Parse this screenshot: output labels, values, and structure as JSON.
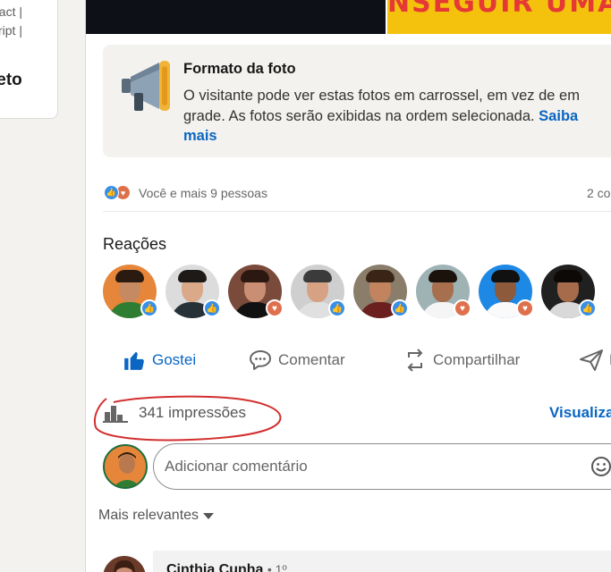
{
  "sidebar": {
    "line1": "eact |",
    "line2": "cript |",
    "title": "leto"
  },
  "media": {
    "banner_text": "NSEGUIR UMA"
  },
  "photo_format": {
    "title": "Formato da foto",
    "text": "O visitante pode ver estas fotos em carrossel, em vez de em grade. As fotos serão exibidas na ordem selecionada.",
    "link": "Saiba mais"
  },
  "social": {
    "reactions_text": "Você e mais 9 pessoas",
    "comments_count": "2 co"
  },
  "reactions": {
    "title": "Reações",
    "people": [
      {
        "badge": "like",
        "bg": "#e6863a",
        "skin": "#c68a62",
        "hair": "#2a1a10",
        "shirt": "#2e7d32"
      },
      {
        "badge": "like",
        "bg": "#dcdcdc",
        "skin": "#d9a98a",
        "hair": "#1e1a17",
        "shirt": "#263238"
      },
      {
        "badge": "love",
        "bg": "#7a4a3a",
        "skin": "#c98e73",
        "hair": "#2b1810",
        "shirt": "#111111"
      },
      {
        "badge": "like",
        "bg": "#cfcfcf",
        "skin": "#d6a283",
        "hair": "#3b3b3b",
        "shirt": "#e0e0e0"
      },
      {
        "badge": "like",
        "bg": "#8a7d6a",
        "skin": "#c1845f",
        "hair": "#3a2416",
        "shirt": "#6b1f1f"
      },
      {
        "badge": "love",
        "bg": "#9fb3b5",
        "skin": "#a86f4f",
        "hair": "#1b120c",
        "shirt": "#f5f5f5"
      },
      {
        "badge": "love",
        "bg": "#1e88e5",
        "skin": "#8d5a3b",
        "hair": "#111111",
        "shirt": "#fafafa"
      },
      {
        "badge": "like",
        "bg": "#202020",
        "skin": "#a56b4a",
        "hair": "#0d0906",
        "shirt": "#d9d9d9"
      }
    ]
  },
  "actions": {
    "like": "Gostei",
    "comment": "Comentar",
    "share": "Compartilhar",
    "send": "E"
  },
  "stats": {
    "impressions": "341 impressões",
    "view_link": "Visualiza"
  },
  "comment_box": {
    "placeholder": "Adicionar comentário"
  },
  "sort": {
    "label": "Mais relevantes"
  },
  "comments": [
    {
      "name": "Cinthia Cunha",
      "degree": "• 1º"
    }
  ],
  "colors": {
    "accent": "#0a66c2",
    "annotation": "#d32f2f",
    "like": "#378fe9",
    "love": "#df704d"
  }
}
